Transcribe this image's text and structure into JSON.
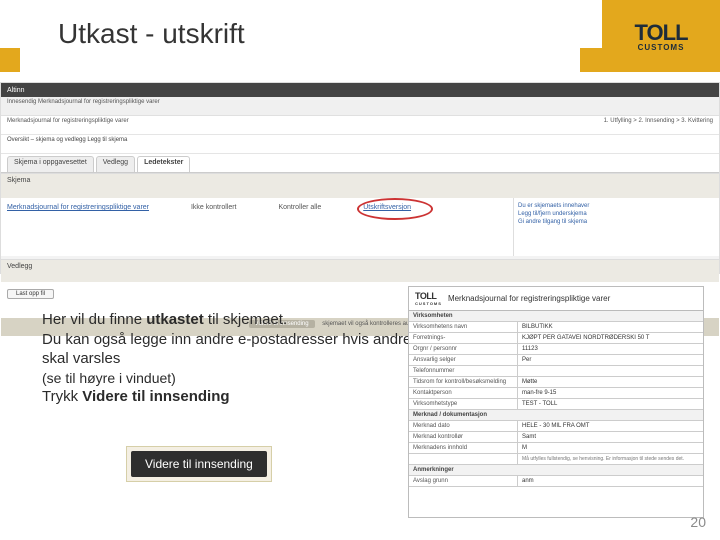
{
  "slide": {
    "title": "Utkast - utskrift",
    "logo": {
      "main": "TOLL",
      "sub": "CUSTOMS"
    },
    "pagenum": "20"
  },
  "screenshot": {
    "appname": "Altinn",
    "path": "Innesendig Merknadsjournal for registreringspliktige varer",
    "breadcrumb_left": "Merknadsjournal for registreringspliktige varer",
    "breadcrumb_right": "1. Utfylling  >  2. Innsending  >  3. Kvittering",
    "steps": "Oversikt – skjema og vedlegg   Legg til skjema",
    "tabs": [
      "Skjema i oppgavesettet",
      "Vedlegg",
      "Ledetekster"
    ],
    "section1": "Skjema",
    "doc_link": "Merknadsjournal for registreringspliktige varer",
    "col_status": "Ikke kontrollert",
    "col_ctrl": "Kontroller alle",
    "col_print": "Utskriftsversjon",
    "right": {
      "a": "Du er skjemaets innehaver",
      "b": "Legg til/fjern underskjema",
      "c": "Gi andre tilgang til skjema"
    },
    "section2": "Vedlegg",
    "btn_attach": "Last opp fil",
    "footer_btn": "Videre til innsending",
    "footer_txt": "skjemaet vil også kontrolleres automatisk før innsending"
  },
  "body": {
    "line1a": "Her vil du finne ",
    "line1b": "utkastet",
    "line1c": " til skjemaet.",
    "line2": "Du kan også legge inn andre e-postadresser hvis andre skal varsles",
    "line3": "(se til høyre i vinduet)",
    "press_a": "Trykk ",
    "press_b": "Videre til innsending",
    "button": "Videre til innsending"
  },
  "form": {
    "title": "Merknadsjournal for registreringspliktige varer",
    "sect1": "Virksomheten",
    "r1k": "Virksomhetens navn",
    "r1v": "BILBUTIKK",
    "r2k": "Forretnings-",
    "r2v": "KJØPT PER GATAVEI NORDTRØDERSKI 50 T",
    "r3k": "Orgnr / personnr",
    "r3v": "11123",
    "r4k": "Ansvarlig selger",
    "r4v": "Per",
    "r5k": "Telefonnummer",
    "r5v": "",
    "r6k": "Tidsrom for kontroll/besøksmelding",
    "r6v": "Møtte",
    "r7k": "Kontaktperson",
    "r7v": "man-fre 9-15",
    "r8k": "Virksomhetstype",
    "r8v": "TEST - TOLL",
    "sect2": "Merknad / dokumentasjon",
    "r9k": "Merknad dato",
    "r9v": "HELE - 30 MIL FRA OMT",
    "r10k": "Merknad kontrollør",
    "r10v": "Samt",
    "r11k": "Merknadens innhold",
    "r11v": "M",
    "box": "Må utfylles fullstendig, se henvisning. Er informasjon til stede sendes det.",
    "sect3": "Anmerkninger",
    "r12k": "Avslag grunn",
    "r12v": "anm"
  }
}
